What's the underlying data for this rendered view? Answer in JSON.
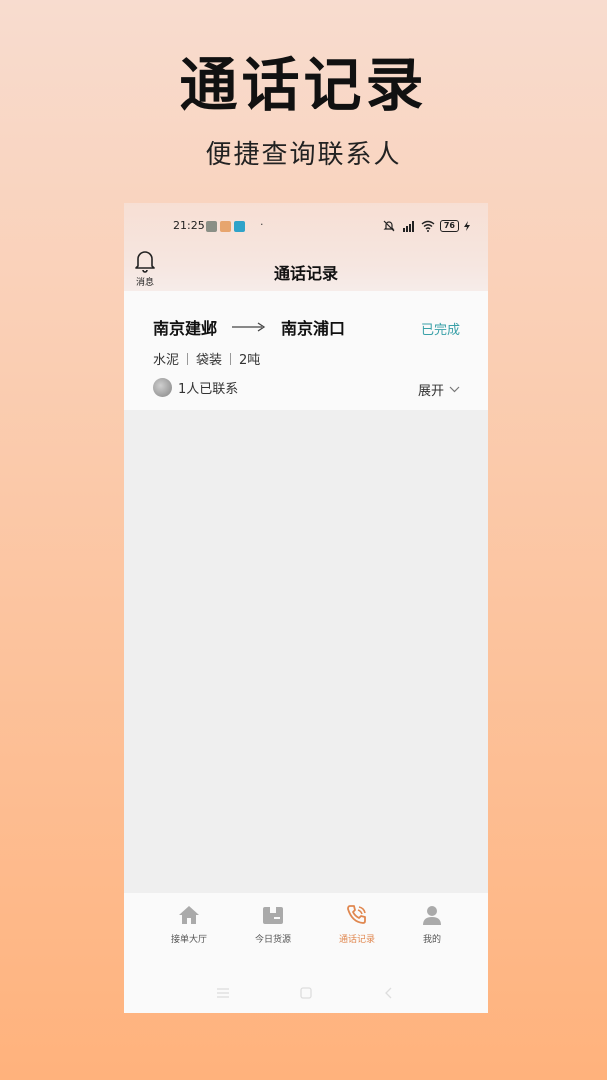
{
  "promo": {
    "headline": "通话记录",
    "subline": "便捷查询联系人"
  },
  "status_bar": {
    "time": "21:25",
    "dot": "·",
    "battery": "76",
    "icons": [
      "mute-bell-icon",
      "hd-signal-icon",
      "wifi-icon",
      "battery-icon",
      "charging-icon"
    ]
  },
  "header": {
    "bell_label": "消息",
    "title": "通话记录"
  },
  "record": {
    "origin": "南京建邺",
    "destination": "南京浦口",
    "status": "已完成",
    "goods": [
      "水泥",
      "袋装",
      "2吨"
    ],
    "contacts": "1人已联系",
    "expand": "展开"
  },
  "tabs": [
    {
      "label": "接单大厅",
      "icon": "home-icon",
      "active": false
    },
    {
      "label": "今日货源",
      "icon": "cargo-box-icon",
      "active": false
    },
    {
      "label": "通话记录",
      "icon": "phone-call-icon",
      "active": true
    },
    {
      "label": "我的",
      "icon": "user-icon",
      "active": false
    }
  ],
  "colors": {
    "accent_orange": "#e0874f",
    "status_teal": "#39a0a8",
    "background_top": "#f8dccf",
    "background_bottom": "#ffb27c"
  }
}
